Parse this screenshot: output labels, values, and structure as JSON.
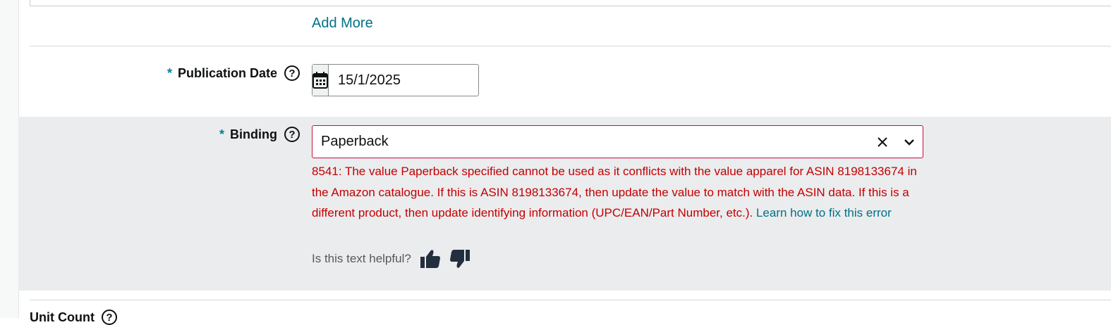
{
  "add_more": {
    "label": "Add More"
  },
  "publication_date": {
    "required_mark": "*",
    "label": "Publication Date",
    "help": "?",
    "value": "15/1/2025",
    "icon": "calendar-icon"
  },
  "binding": {
    "required_mark": "*",
    "label": "Binding",
    "help": "?",
    "value": "Paperback",
    "clear_icon": "close-icon",
    "dropdown_icon": "chevron-down-icon",
    "error_message": "8541: The value Paperback specified cannot be used as it conflicts with the value apparel for ASIN 8198133674 in the Amazon catalogue. If this is ASIN 8198133674, then update the value to match with the ASIN data. If this is a different product, then update identifying information (UPC/EAN/Part Number, etc.).",
    "error_link": "Learn how to fix this error",
    "helpful_prompt": "Is this text helpful?",
    "thumbs_up_icon": "thumbs-up-icon",
    "thumbs_down_icon": "thumbs-down-icon"
  },
  "next_field": {
    "label": "Unit Count",
    "help": "?"
  },
  "colors": {
    "link": "#007185",
    "error": "#c40000",
    "error_border": "#cc0c39",
    "required": "#008296",
    "band": "#ebecee"
  }
}
